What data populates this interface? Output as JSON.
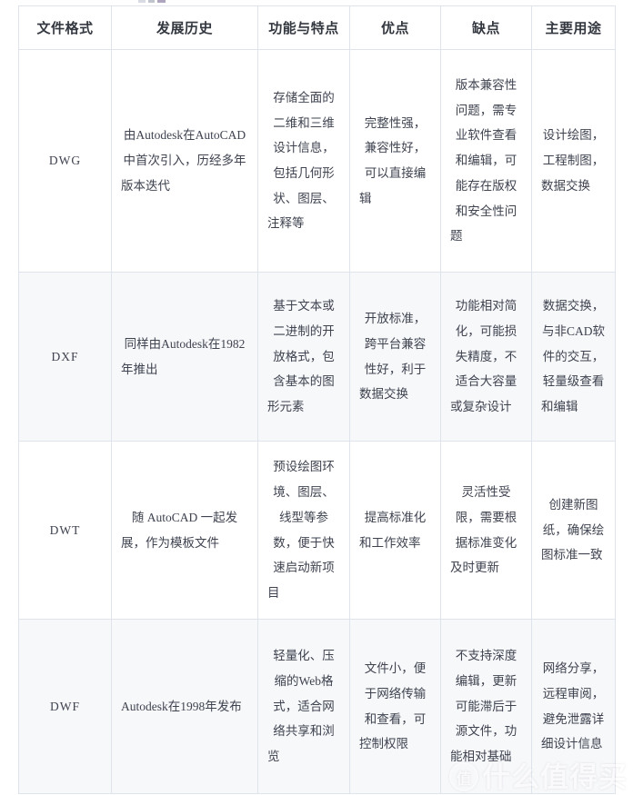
{
  "table": {
    "headers": [
      "文件格式",
      "发展历史",
      "功能与特点",
      "优点",
      "缺点",
      "主要用途"
    ],
    "rows": [
      {
        "format": "DWG",
        "history": "由Autodesk在AutoCAD中首次引入，历经多年版本迭代",
        "features": "存储全面的二维和三维设计信息，包括几何形状、图层、注释等",
        "pros": "完整性强，兼容性好，可以直接编辑",
        "cons": "版本兼容性问题，需专业软件查看和编辑，可能存在版权和安全性问题",
        "uses": "设计绘图，工程制图，数据交换"
      },
      {
        "format": "DXF",
        "history": "同样由Autodesk在1982年推出",
        "features": "基于文本或二进制的开放格式，包含基本的图形元素",
        "pros": "开放标准，跨平台兼容性好，利于数据交换",
        "cons": "功能相对简化，可能损失精度，不适合大容量或复杂设计",
        "uses": "数据交换，与非CAD软件的交互，轻量级查看和编辑"
      },
      {
        "format": "DWT",
        "history": "随 AutoCAD 一起发展，作为模板文件",
        "features": "预设绘图环境、图层、线型等参数，便于快速启动新项目",
        "pros": "提高标准化和工作效率",
        "cons": "灵活性受限，需要根据标准变化及时更新",
        "uses": "创建新图纸，确保绘图标准一致"
      },
      {
        "format": "DWF",
        "history": "Autodesk在1998年发布",
        "features": "轻量化、压缩的Web格式，适合网络共享和浏览",
        "pros": "文件小，便于网络传输和查看，可控制权限",
        "cons": "不支持深度编辑，更新可能滞后于源文件，功能相对基础",
        "uses": "网络分享，远程审阅，避免泄露详细设计信息"
      }
    ]
  },
  "watermark": {
    "mark": "值",
    "text": "什么值得买"
  }
}
